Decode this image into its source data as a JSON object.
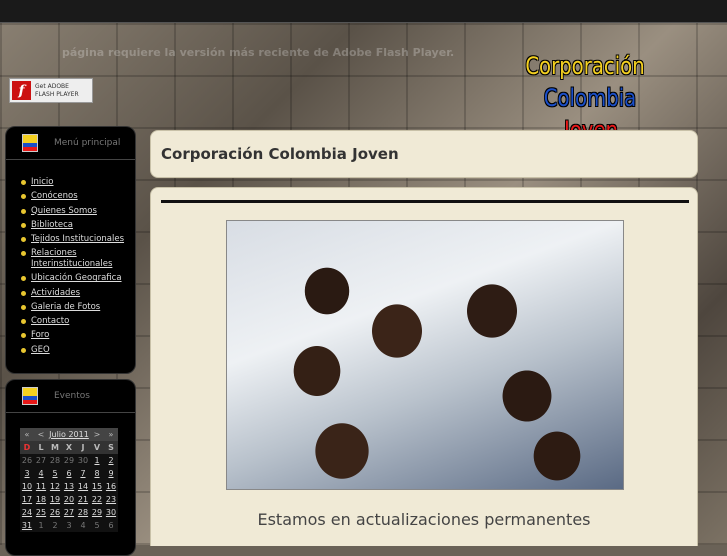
{
  "header": {
    "flash_message": "página requiere la versión más reciente de Adobe Flash Player.",
    "flash_badge": {
      "line1": "Get ADOBE",
      "line2": "FLASH PLAYER"
    },
    "logo": {
      "line1": "Corporación",
      "line2": "Colombia",
      "line3": "Joven"
    }
  },
  "sidebar": {
    "menu_title": "Menú principal",
    "items": [
      {
        "label": "Inicio"
      },
      {
        "label": "Conócenos"
      },
      {
        "label": "Quienes Somos"
      },
      {
        "label": "Biblioteca"
      },
      {
        "label": "Tejidos Institucionales"
      },
      {
        "label": "Relaciones Interinstitucionales"
      },
      {
        "label": "Ubicación Geografica"
      },
      {
        "label": "Actividades"
      },
      {
        "label": "Galeria de Fotos"
      },
      {
        "label": "Contacto"
      },
      {
        "label": "Foro"
      },
      {
        "label": "GEO"
      }
    ],
    "events_title": "Eventos"
  },
  "calendar": {
    "prev_year": "«",
    "prev_month": "<",
    "month": "Julio 2011",
    "next_month": ">",
    "next_year": "»",
    "weekdays": [
      "D",
      "L",
      "M",
      "X",
      "J",
      "V",
      "S"
    ],
    "weeks": [
      [
        "26",
        "27",
        "28",
        "29",
        "30",
        "1",
        "2"
      ],
      [
        "3",
        "4",
        "5",
        "6",
        "7",
        "8",
        "9"
      ],
      [
        "10",
        "11",
        "12",
        "13",
        "14",
        "15",
        "16"
      ],
      [
        "17",
        "18",
        "19",
        "20",
        "21",
        "22",
        "23"
      ],
      [
        "24",
        "25",
        "26",
        "27",
        "28",
        "29",
        "30"
      ],
      [
        "31",
        "1",
        "2",
        "3",
        "4",
        "5",
        "6"
      ]
    ],
    "selected_day": "8"
  },
  "main": {
    "title": "Corporación Colombia Joven",
    "caption": "Estamos en actualizaciones permanentes"
  },
  "colors": {
    "accent_yellow": "#f4d020",
    "accent_blue": "#1a4ec8",
    "accent_red": "#e81818",
    "content_bg": "#f0ead6"
  }
}
